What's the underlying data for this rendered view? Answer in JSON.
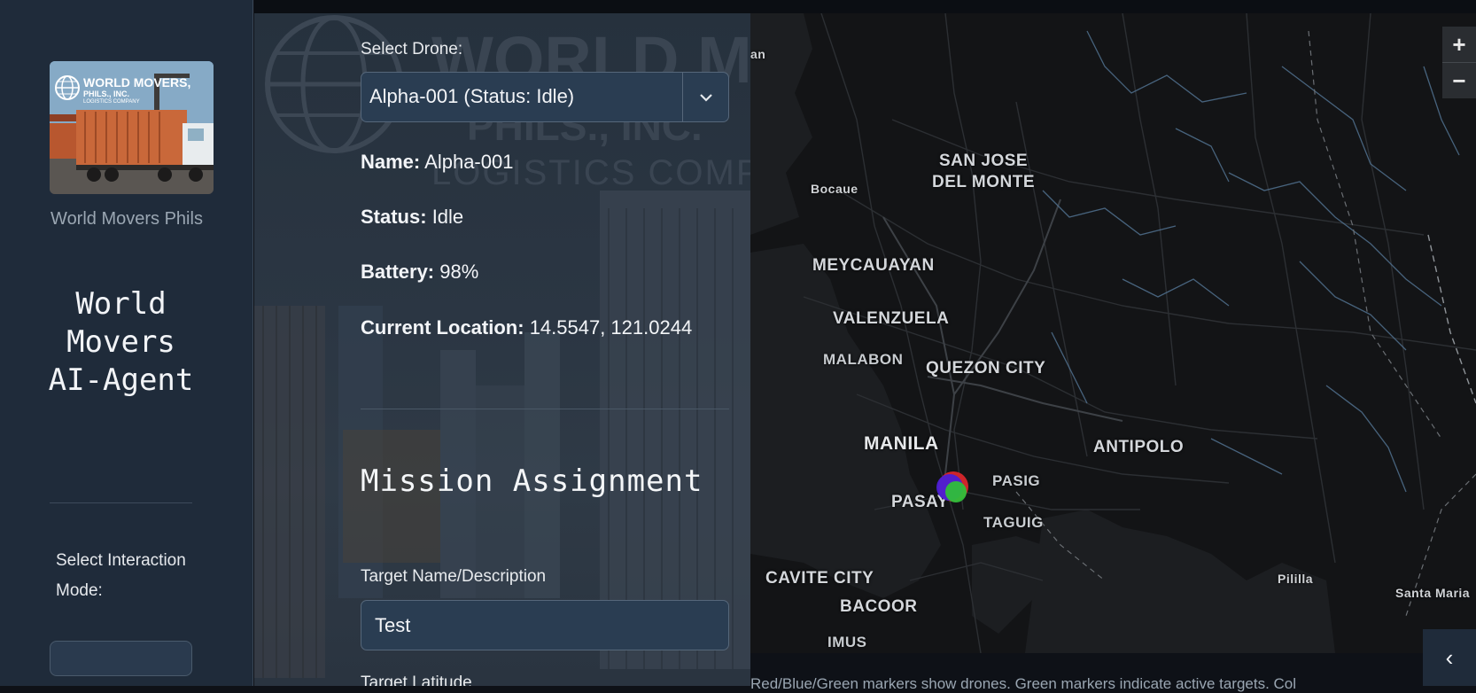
{
  "sidebar": {
    "logo": {
      "line1": "WORLD MOVERS,",
      "line2": "PHILS., INC.",
      "line3": "LOGISTICS COMPANY"
    },
    "logo_caption": "World Movers Phils",
    "app_title": "World Movers AI-Agent",
    "mode_label": "Select Interaction Mode:"
  },
  "panel": {
    "select_drone_label": "Select Drone:",
    "selected_drone": "Alpha-001 (Status: Idle)",
    "name_label": "Name:",
    "name_value": "Alpha-001",
    "status_label": "Status:",
    "status_value": "Idle",
    "battery_label": "Battery:",
    "battery_value": "98%",
    "location_label": "Current Location:",
    "location_value": "14.5547, 121.0244",
    "section_title": "Mission Assignment",
    "target_name_label": "Target Name/Description",
    "target_name_value": "Test",
    "target_latitude_label": "Target Latitude"
  },
  "background_watermark": {
    "line1": "WORLD M",
    "line2": "PHILS., INC.",
    "line3": "LOGISTICS COMPA"
  },
  "map": {
    "labels": {
      "partial_top_left": "an",
      "san_jose_1": "SAN JOSE",
      "san_jose_2": "DEL MONTE",
      "bocaue": "Bocaue",
      "meycauayan": "MEYCAUAYAN",
      "valenzuela": "VALENZUELA",
      "malabon": "MALABON",
      "quezon_city": "QUEZON CITY",
      "manila": "MANILA",
      "antipolo": "ANTIPOLO",
      "pasig": "PASIG",
      "pasay": "PASAY",
      "taguig": "TAGUIG",
      "cavite_city": "CAVITE CITY",
      "bacoor": "BACOOR",
      "imus": "IMUS",
      "pililla": "Pililla",
      "santa_maria": "Santa Maria"
    },
    "zoom_in": "+",
    "zoom_out": "−",
    "marker_colors": [
      "#d8262b",
      "#4b1fd6",
      "#2fbf3a"
    ],
    "legend_text": "Red/Blue/Green markers show drones. Green markers indicate active targets. Col"
  },
  "collapse_icon": "‹"
}
